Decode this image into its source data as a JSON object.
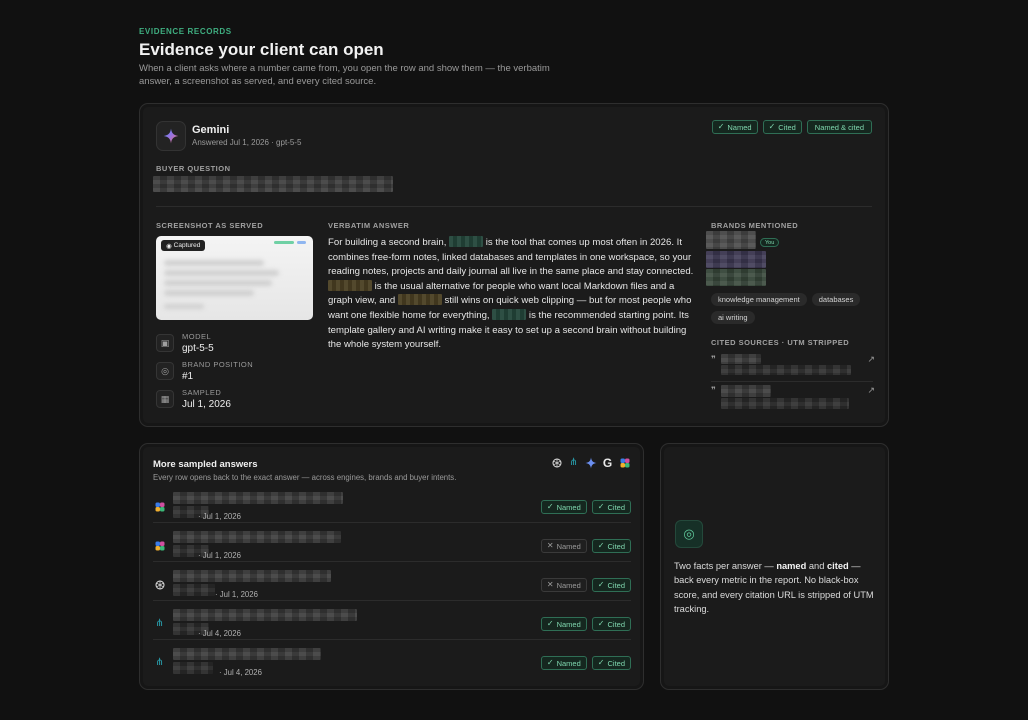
{
  "header": {
    "eyebrow": "EVIDENCE RECORDS",
    "title": "Evidence your client can open",
    "subtitle": "When a client asks where a number came from, you open the row and show them — the verbatim answer, a screenshot as served, and every cited source."
  },
  "record": {
    "engine": "Gemini",
    "answered": "Answered Jul 1, 2026 · gpt-5-5",
    "badges": [
      "Named",
      "Cited",
      "Named & cited"
    ],
    "buyer_question_label": "BUYER QUESTION",
    "screenshot_label": "SCREENSHOT AS SERVED",
    "screenshot_caption": "Captured",
    "verbatim_label": "VERBATIM ANSWER",
    "verbatim_parts": [
      "For building a second brain, ",
      " is the tool that comes up most often in 2026. It combines free-form notes, linked databases and templates in one workspace, so your reading notes, projects and daily journal all live in the same place and stay connected. ",
      " is the usual alternative for people who want local Markdown files and a graph view, and ",
      " still wins on quick web clipping — but for most people who want one flexible home for everything, ",
      " is the recommended starting point. Its template gallery and AI writing make it easy to set up a second brain without building the whole system yourself."
    ],
    "meta": {
      "model_label": "MODEL",
      "model_value": "gpt-5-5",
      "position_label": "BRAND POSITION",
      "position_value": "#1",
      "sampled_label": "SAMPLED",
      "sampled_value": "Jul 1, 2026"
    },
    "brands_label": "BRANDS MENTIONED",
    "you_badge": "You",
    "topics": [
      "knowledge management",
      "databases",
      "ai writing"
    ],
    "sources_label": "CITED SOURCES · UTM STRIPPED"
  },
  "more": {
    "title": "More sampled answers",
    "subtitle": "Every row opens back to the exact answer — across engines, brands and buyer intents.",
    "engine_icons": [
      "chatgpt-icon",
      "perplexity-icon",
      "gemini-icon",
      "google-icon",
      "copilot-icon"
    ],
    "rows": [
      {
        "engine": "copilot-icon",
        "date": "· Jul 1, 2026",
        "named": "Named",
        "named_on": true,
        "cited": "Cited"
      },
      {
        "engine": "copilot-icon",
        "date": "· Jul 1, 2026",
        "named": "Named",
        "named_on": false,
        "cited": "Cited"
      },
      {
        "engine": "chatgpt-icon",
        "date": "· Jul 1, 2026",
        "named": "Named",
        "named_on": false,
        "cited": "Cited"
      },
      {
        "engine": "perplexity-icon",
        "date": "· Jul 4, 2026",
        "named": "Named",
        "named_on": true,
        "cited": "Cited"
      },
      {
        "engine": "perplexity-icon",
        "date": "· Jul 4, 2026",
        "named": "Named",
        "named_on": true,
        "cited": "Cited"
      }
    ]
  },
  "facts": {
    "text_a": "Two facts per answer — ",
    "named": "named",
    "text_b": " and ",
    "cited": "cited",
    "text_c": " — back every metric in the report. No black-box score, and every citation URL is stripped of UTM tracking."
  },
  "colors": {
    "accent": "#3fae80",
    "badge_text": "#7fd6ae",
    "badge_bg": "#15271f",
    "background": "#111111",
    "card": "#1b1b1b"
  }
}
